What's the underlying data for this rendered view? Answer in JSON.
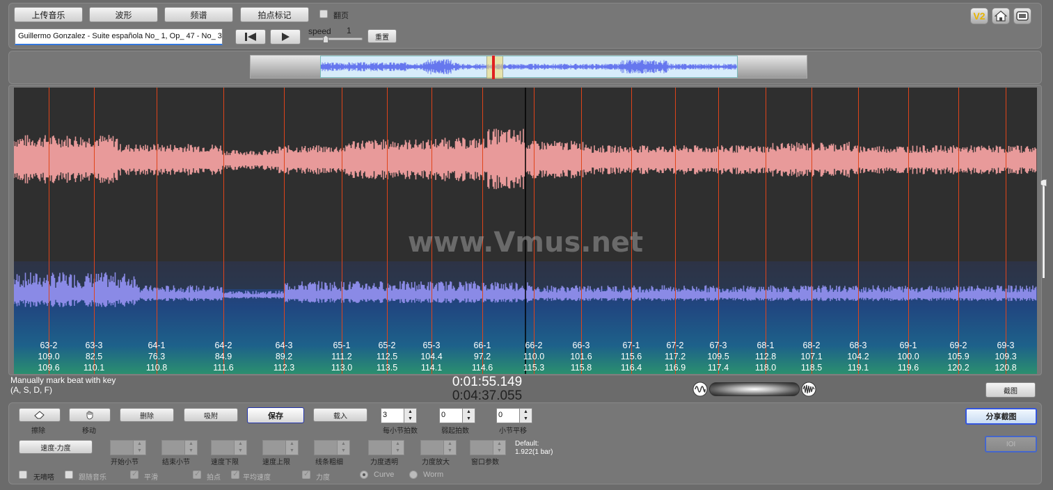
{
  "top": {
    "upload_label": "上传音乐",
    "waveform_label": "波形",
    "spectrum_label": "频谱",
    "beatmark_label": "拍点标记",
    "flip_label": "翻页",
    "track_name": "Guillermo Gonzalez - Suite española No_ 1, Op_ 47 - No_ 3",
    "speed_label": "speed",
    "speed_value": "1",
    "reset_label": "重置",
    "v2_label": "V2"
  },
  "main": {
    "watermark": "www.Vmus.net",
    "beats": [
      {
        "bar": "63-2",
        "tempo": "109.0",
        "time": "109.6"
      },
      {
        "bar": "63-3",
        "tempo": "82.5",
        "time": "110.1"
      },
      {
        "bar": "64-1",
        "tempo": "76.3",
        "time": "110.8"
      },
      {
        "bar": "64-2",
        "tempo": "84.9",
        "time": "111.6"
      },
      {
        "bar": "64-3",
        "tempo": "89.2",
        "time": "112.3"
      },
      {
        "bar": "65-1",
        "tempo": "111.2",
        "time": "113.0"
      },
      {
        "bar": "65-2",
        "tempo": "112.5",
        "time": "113.5"
      },
      {
        "bar": "65-3",
        "tempo": "104.4",
        "time": "114.1"
      },
      {
        "bar": "66-1",
        "tempo": "97.2",
        "time": "114.6"
      },
      {
        "bar": "66-2",
        "tempo": "110.0",
        "time": "115.3"
      },
      {
        "bar": "66-3",
        "tempo": "101.6",
        "time": "115.8"
      },
      {
        "bar": "67-1",
        "tempo": "115.6",
        "time": "116.4"
      },
      {
        "bar": "67-2",
        "tempo": "117.2",
        "time": "116.9"
      },
      {
        "bar": "67-3",
        "tempo": "109.5",
        "time": "117.4"
      },
      {
        "bar": "68-1",
        "tempo": "112.8",
        "time": "118.0"
      },
      {
        "bar": "68-2",
        "tempo": "107.1",
        "time": "118.5"
      },
      {
        "bar": "68-3",
        "tempo": "104.2",
        "time": "119.1"
      },
      {
        "bar": "69-1",
        "tempo": "100.0",
        "time": "119.6"
      },
      {
        "bar": "69-2",
        "tempo": "105.9",
        "time": "120.2"
      },
      {
        "bar": "69-3",
        "tempo": "109.3",
        "time": "120.8"
      }
    ]
  },
  "status": {
    "hint_line1": "Manually mark beat with key",
    "hint_line2": "(A, S, D, F)",
    "current_time": "0:01:55.149",
    "total_time": "0:04:37.055",
    "screenshot_label": "截图"
  },
  "bottom": {
    "erase_label": "擦除",
    "move_label": "移动",
    "delete_label": "删除",
    "snap_label": "吸附",
    "save_label": "保存",
    "load_label": "载入",
    "beats_per_bar_value": "3",
    "beats_per_bar_label": "每小节拍数",
    "pickup_value": "0",
    "pickup_label": "弱起拍数",
    "bar_shift_value": "0",
    "bar_shift_label": "小节平移",
    "share_label": "分享截图",
    "ioi_label": "IOI",
    "tempo_dyn_label": "速度-力度",
    "start_bar_label": "开始小节",
    "end_bar_label": "结束小节",
    "tempo_low_label": "速度下限",
    "tempo_high_label": "速度上限",
    "line_width_label": "线条粗细",
    "dyn_opacity_label": "力度透明",
    "dyn_zoom_label": "力度放大",
    "window_param_label": "窗口参数",
    "default_label": "Default:",
    "default_value": "1.922(1 bar)",
    "no_tick_label": "无嘀嗒",
    "follow_music_label": "跟随音乐",
    "smooth_label": "平滑",
    "beat_label": "拍点",
    "avg_tempo_label": "平均速度",
    "dynamics_label": "力度",
    "curve_label": "Curve",
    "worm_label": "Worm"
  }
}
